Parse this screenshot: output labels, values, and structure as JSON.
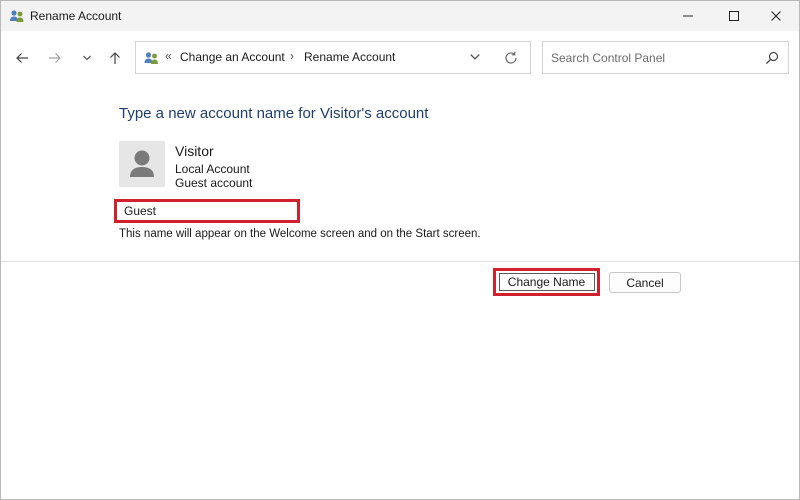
{
  "window": {
    "title": "Rename Account",
    "title_icon": "users-icon"
  },
  "nav": {
    "back_icon": "arrow-left-icon",
    "forward_icon": "arrow-right-icon",
    "recent_icon": "chevron-down-icon",
    "up_icon": "arrow-up-icon"
  },
  "address": {
    "icon": "users-icon",
    "separator": "«",
    "crumbs": [
      "Change an Account",
      "Rename Account"
    ],
    "crumb_separator": "›"
  },
  "search": {
    "placeholder": "Search Control Panel"
  },
  "main": {
    "heading": "Type a new account name for Visitor's account",
    "account": {
      "name": "Visitor",
      "type": "Local Account",
      "group": "Guest account"
    },
    "new_name_value": "Guest",
    "hint": "This name will appear on the Welcome screen and on the Start screen.",
    "change_label": "Change Name",
    "cancel_label": "Cancel"
  },
  "colors": {
    "heading": "#1e3e6e",
    "highlight": "#d1202e"
  }
}
